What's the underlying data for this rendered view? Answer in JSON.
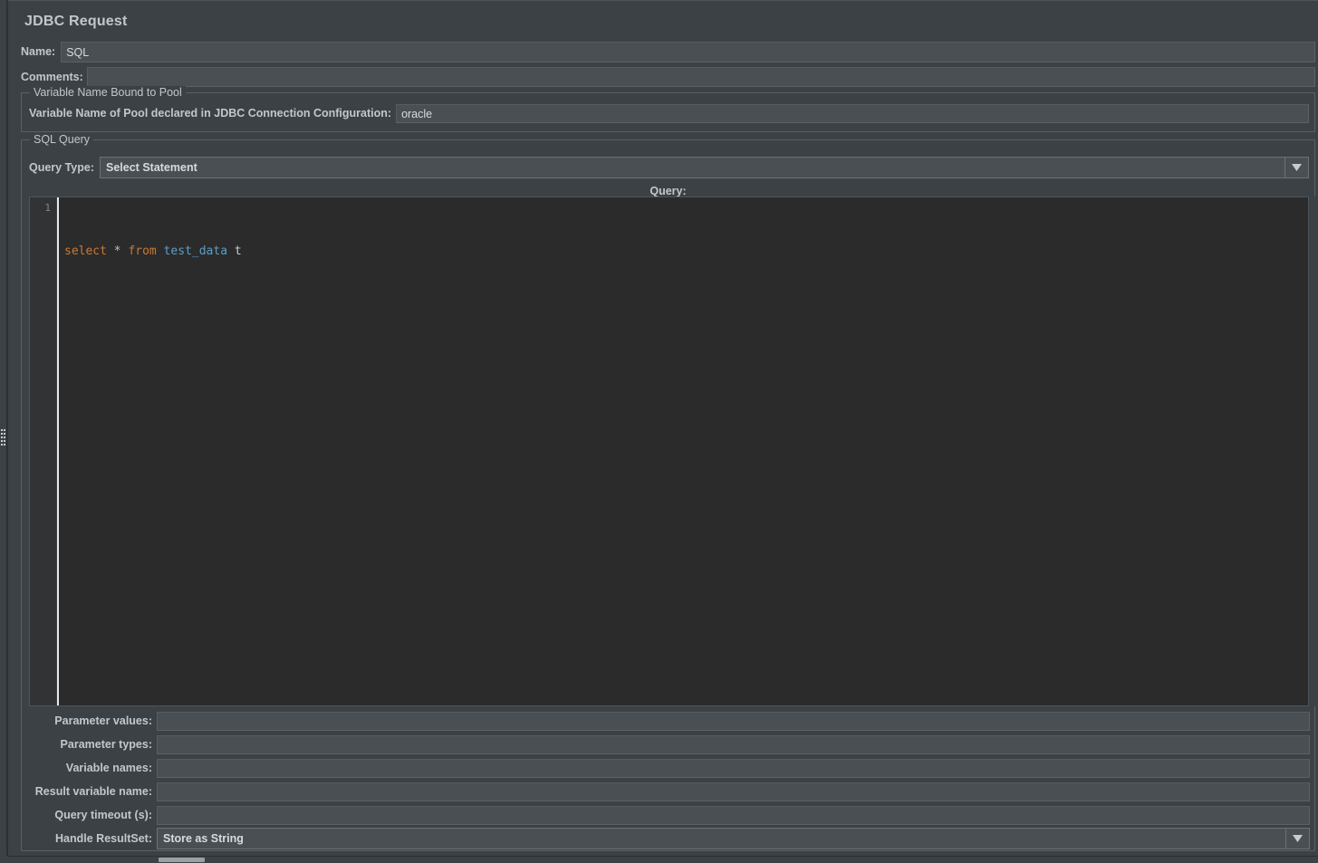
{
  "panel": {
    "title": "JDBC Request"
  },
  "fields": {
    "name_label": "Name:",
    "name_value": "SQL",
    "comments_label": "Comments:",
    "comments_value": ""
  },
  "pool_group": {
    "title": "Variable Name Bound to Pool",
    "label": "Variable Name of Pool declared in JDBC Connection Configuration:",
    "value": "oracle"
  },
  "sql_group": {
    "title": "SQL Query",
    "query_type_label": "Query Type:",
    "query_type_value": "Select Statement",
    "query_caption": "Query:"
  },
  "editor": {
    "line_number": "1",
    "query_text": "select * from test_data t",
    "tokens": {
      "kw_select": "select",
      "op_star": "*",
      "kw_from": "from",
      "table": "test_data",
      "alias": "t"
    }
  },
  "params": {
    "parameter_values_label": "Parameter values:",
    "parameter_values": "",
    "parameter_types_label": "Parameter types:",
    "parameter_types": "",
    "variable_names_label": "Variable names:",
    "variable_names": "",
    "result_variable_name_label": "Result variable name:",
    "result_variable_name": "",
    "query_timeout_label": "Query timeout (s):",
    "query_timeout": "",
    "handle_resultset_label": "Handle ResultSet:",
    "handle_resultset_value": "Store as String"
  },
  "colors": {
    "panel_bg": "#3c4145",
    "field_bg": "#4a4f53",
    "editor_bg": "#2b2b2b",
    "gutter_bg": "#313335",
    "text": "#c2c7cb",
    "keyword": "#cc7832",
    "table_token": "#5c9ec7",
    "caret": "#e8e8e8"
  }
}
